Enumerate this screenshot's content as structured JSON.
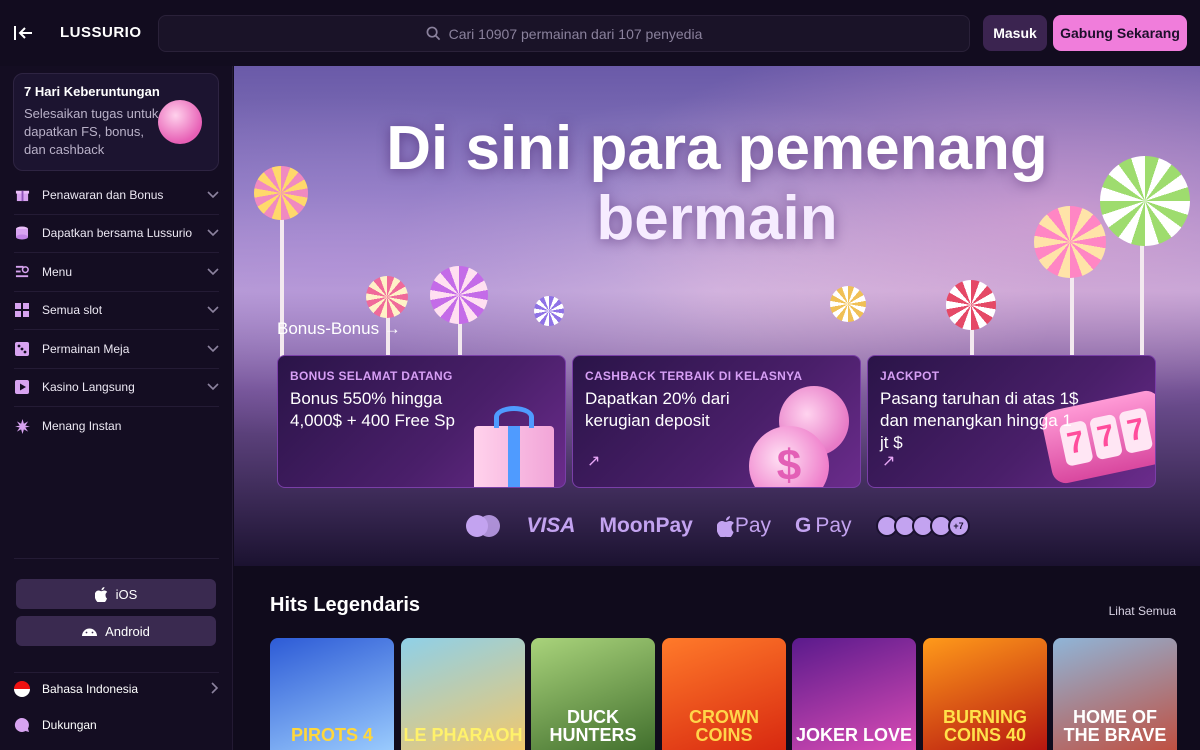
{
  "header": {
    "logo": "LUSSURIO",
    "search_placeholder": "Cari 10907 permainan dari 107 penyedia",
    "login_label": "Masuk",
    "join_label": "Gabung Sekarang"
  },
  "sidebar": {
    "promo": {
      "title": "7 Hari Keberuntungan",
      "description": "Selesaikan tugas untuk dapatkan FS, bonus, dan cashback"
    },
    "items": [
      {
        "label": "Penawaran dan Bonus",
        "icon": "gift-icon"
      },
      {
        "label": "Dapatkan bersama Lussurio",
        "icon": "coins-icon"
      },
      {
        "label": "Menu",
        "icon": "menu-search-icon"
      },
      {
        "label": "Semua slot",
        "icon": "grid-icon"
      },
      {
        "label": "Permainan Meja",
        "icon": "dice-icon"
      },
      {
        "label": "Kasino Langsung",
        "icon": "play-icon"
      },
      {
        "label": "Menang Instan",
        "icon": "burst-icon"
      }
    ],
    "ios_label": "iOS",
    "android_label": "Android",
    "language_label": "Bahasa Indonesia",
    "support_label": "Dukungan"
  },
  "hero": {
    "title_line1": "Di sini para pemenang",
    "title_line2": "bermain"
  },
  "bonuses": {
    "heading": "Bonus-Bonus →",
    "cards": [
      {
        "label": "BONUS SELAMAT DATANG",
        "text": "Bonus 550% hingga 4,000$ + 400 Free Sp"
      },
      {
        "label": "CASHBACK TERBAIK DI KELASNYA",
        "text": "Dapatkan 20% dari kerugian deposit"
      },
      {
        "label": "JACKPOT",
        "text": "Pasang taruhan di atas 1$ dan menangkan hingga 1 jt $"
      }
    ]
  },
  "payments": {
    "visa": "VISA",
    "moonpay": "MoonPay",
    "applepay": "Pay",
    "googlepay": "Pay",
    "more": "+7"
  },
  "hits": {
    "title": "Hits Legendaris",
    "see_all": "Lihat Semua",
    "games": [
      {
        "name": "PIROTS 4",
        "colors": [
          "#2d5bd6",
          "#9fd0ff"
        ]
      },
      {
        "name": "LE PHARAOH",
        "colors": [
          "#f6c766",
          "#8fd0e8"
        ]
      },
      {
        "name": "DUCK HUNTERS",
        "colors": [
          "#3d6b2a",
          "#a9d37b"
        ]
      },
      {
        "name": "CROWN COINS",
        "colors": [
          "#d6250f",
          "#ff7a2a"
        ]
      },
      {
        "name": "JOKER LOVE",
        "colors": [
          "#5a1a8c",
          "#e14fb7"
        ]
      },
      {
        "name": "BURNING COINS 40",
        "colors": [
          "#b31010",
          "#ff9a1a"
        ]
      },
      {
        "name": "HOME OF THE BRAVE",
        "colors": [
          "#8fb5d8",
          "#c24b3a"
        ]
      }
    ]
  }
}
